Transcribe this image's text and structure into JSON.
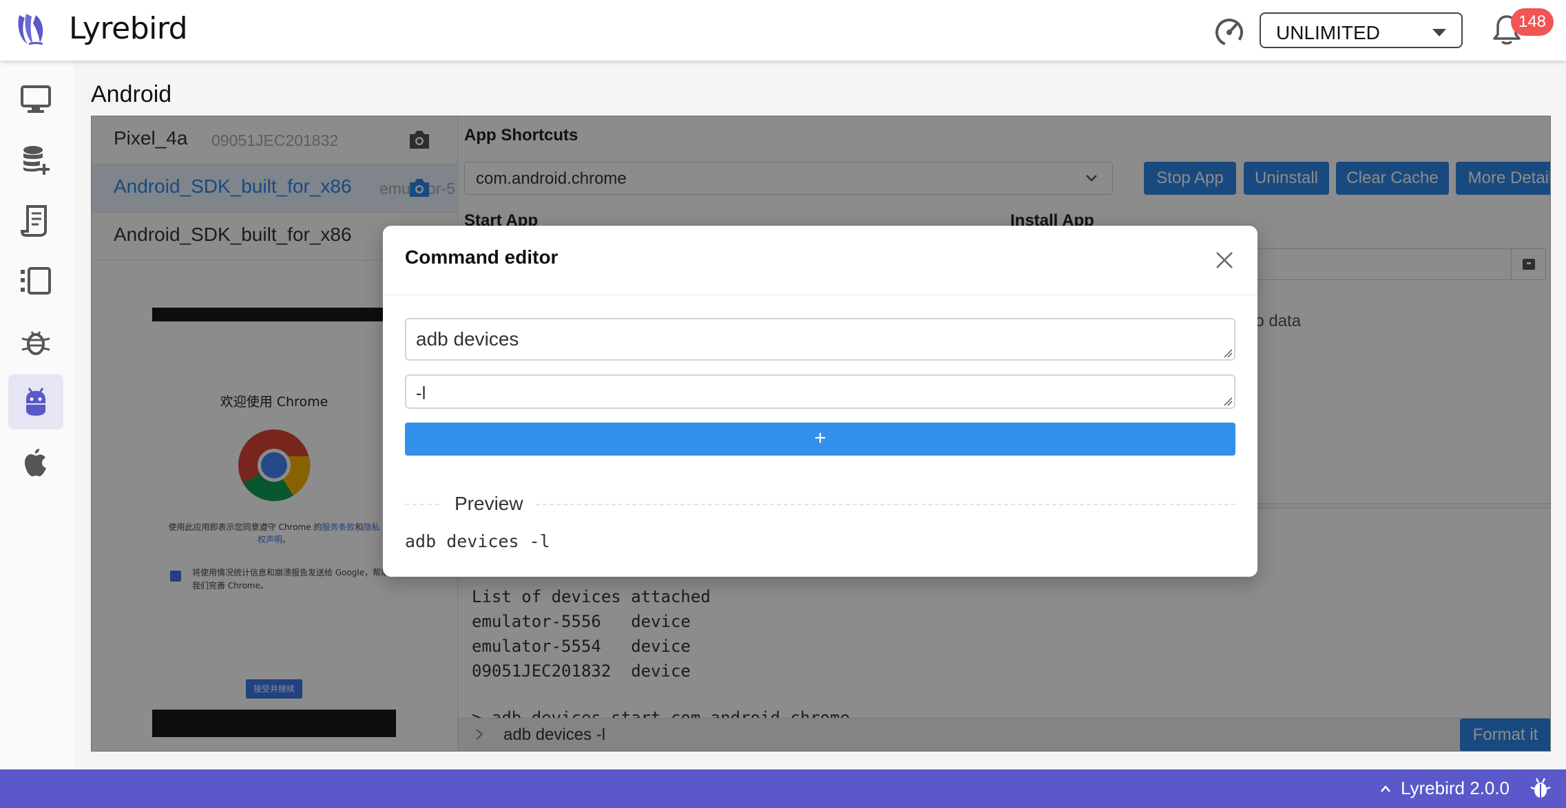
{
  "header": {
    "app_name": "Lyrebird",
    "speed_value": "UNLIMITED",
    "notification_count": "148"
  },
  "sidebar": {
    "items": [
      {
        "icon": "monitor-icon"
      },
      {
        "icon": "database-add-icon"
      },
      {
        "icon": "document-icon"
      },
      {
        "icon": "timeline-icon"
      },
      {
        "icon": "bug-icon"
      },
      {
        "icon": "android-icon",
        "active": true
      },
      {
        "icon": "apple-icon"
      }
    ]
  },
  "page": {
    "title": "Android"
  },
  "devices": [
    {
      "name": "Pixel_4a",
      "serial": "09051JEC201832"
    },
    {
      "name": "Android_SDK_built_for_x86",
      "serial": "emulator-5",
      "active": true
    },
    {
      "name": "Android_SDK_built_for_x86",
      "serial": ""
    }
  ],
  "phone_screen": {
    "welcome": "欢迎使用 Chrome",
    "tos_prefix": "使用此应用即表示您同意遵守 Chrome 的",
    "tos_link1": "服务条款",
    "tos_and": "和",
    "tos_link2": "隐私权声明",
    "tos_end": "。",
    "checkbox_text": "将使用情况统计信息和崩溃报告发送给 Google，帮助我们完善 Chrome。",
    "accept": "接受并继续"
  },
  "shortcuts": {
    "title": "App Shortcuts",
    "package": "com.android.chrome",
    "buttons": [
      "Stop App",
      "Uninstall",
      "Clear Cache",
      "More Detail"
    ],
    "start_app_title": "Start App",
    "install_app_title": "Install App",
    "no_data": "No data"
  },
  "console": {
    "output": "List of devices attached\nemulator-5556   device\nemulator-5554   device\n09051JEC201832  device",
    "next_line": "> adb devices start com.android.chrome",
    "input": "adb devices -l",
    "format_button": "Format it"
  },
  "modal": {
    "title": "Command editor",
    "command": "adb devices",
    "arg": "-l",
    "add_label": "+",
    "preview_label": "Preview",
    "preview": "adb devices -l"
  },
  "footer": {
    "version": "Lyrebird 2.0.0"
  },
  "colors": {
    "brand": "#5b58c9",
    "primary": "#2f88e8",
    "badge": "#f25454"
  }
}
